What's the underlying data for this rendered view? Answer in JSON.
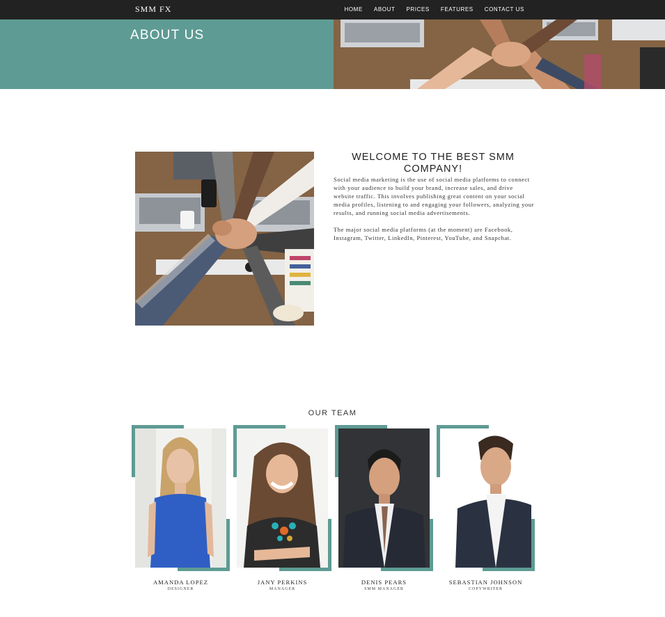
{
  "nav": {
    "brand": "SMM FX",
    "links": [
      "HOME",
      "ABOUT",
      "PRICES",
      "FEATURES",
      "CONTACT US"
    ]
  },
  "hero": {
    "title": "ABOUT US"
  },
  "intro": {
    "title": "WELCOME TO THE BEST SMM COMPANY!",
    "paragraph1": "Social media marketing is the use of social media platforms to connect with your audience to build your brand, increase sales, and drive website traffic. This involves publishing great content on your social media profiles, listening to and engaging your followers, analyzing your results, and running social media advertisements.",
    "paragraph2": "The major social media platforms (at the moment) are Facebook, Instagram, Twitter, LinkedIn, Pinterest, YouTube, and Snapchat."
  },
  "team": {
    "heading": "OUR TEAM",
    "members": [
      {
        "name": "AMANDA LOPEZ",
        "role": "DESIGNER"
      },
      {
        "name": "JANY PERKINS",
        "role": "MANAGER"
      },
      {
        "name": "DENIS PEARS",
        "role": "SMM MANAGER"
      },
      {
        "name": "SEBASTIAN JOHNSON",
        "role": "COPYWRITER"
      }
    ]
  },
  "colors": {
    "accent": "#5e9b94",
    "navbar": "#222222"
  }
}
